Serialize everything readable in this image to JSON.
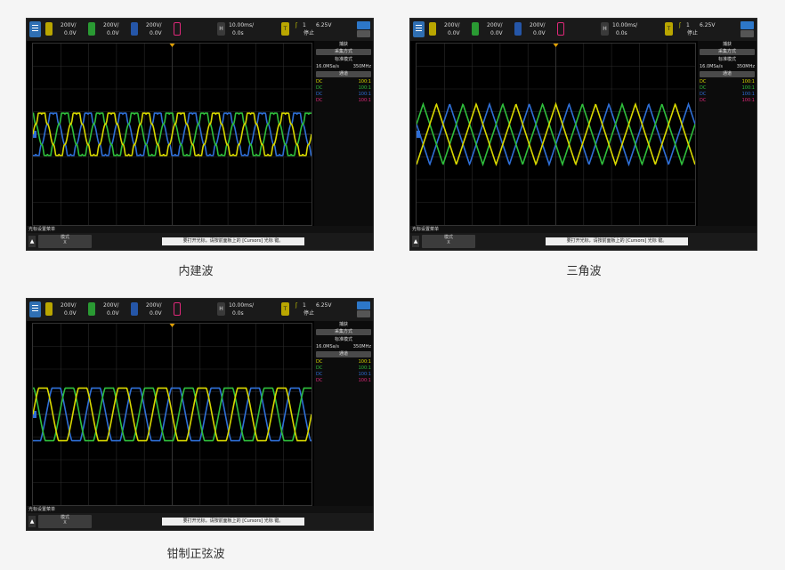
{
  "scopes": [
    {
      "caption": "内建波",
      "waveform": "builtin",
      "channels": [
        {
          "scale": "200V/",
          "offset": "0.0V",
          "color": "#d8d800"
        },
        {
          "scale": "200V/",
          "offset": "0.0V",
          "color": "#2fbe3c"
        },
        {
          "scale": "200V/",
          "offset": "0.0V",
          "color": "#2f6fd6"
        },
        {
          "scale": "",
          "offset": "",
          "color": "#e0287a"
        }
      ],
      "timebase": {
        "label": "H",
        "scale": "10.00ms/",
        "delay": "0.0s"
      },
      "trigger": {
        "label": "T",
        "slope": "ʃ",
        "channel": "1",
        "level": "6.25V",
        "status": "停止"
      },
      "side_panel": {
        "tab_label": "捕获",
        "acq_mode_button": "采集方式",
        "acq_mode_value": "标准模式",
        "sample_rate": "16.0MSa/s",
        "bandwidth": "350MHz",
        "channel_button": "通道",
        "channels": [
          {
            "coupling": "DC",
            "probe": "100:1",
            "color": "#d8d800"
          },
          {
            "coupling": "DC",
            "probe": "100:1",
            "color": "#2fbe3c"
          },
          {
            "coupling": "DC",
            "probe": "100:1",
            "color": "#2f6fd6"
          },
          {
            "coupling": "DC",
            "probe": "100:1",
            "color": "#e0287a"
          }
        ]
      },
      "status_line": "光标设置菜单",
      "softkey": {
        "label": "模式",
        "value": "X"
      },
      "message": "要打开光标，请按前面板上的 [Cursors] 光标 键。"
    },
    {
      "caption": "三角波",
      "waveform": "triangle",
      "channels": [
        {
          "scale": "200V/",
          "offset": "0.0V",
          "color": "#d8d800"
        },
        {
          "scale": "200V/",
          "offset": "0.0V",
          "color": "#2fbe3c"
        },
        {
          "scale": "200V/",
          "offset": "0.0V",
          "color": "#2f6fd6"
        },
        {
          "scale": "",
          "offset": "",
          "color": "#e0287a"
        }
      ],
      "timebase": {
        "label": "H",
        "scale": "10.00ms/",
        "delay": "0.0s"
      },
      "trigger": {
        "label": "T",
        "slope": "ʃ",
        "channel": "1",
        "level": "6.25V",
        "status": "停止"
      },
      "side_panel": {
        "tab_label": "捕获",
        "acq_mode_button": "采集方式",
        "acq_mode_value": "标准模式",
        "sample_rate": "16.0MSa/s",
        "bandwidth": "350MHz",
        "channel_button": "通道",
        "channels": [
          {
            "coupling": "DC",
            "probe": "100:1",
            "color": "#d8d800"
          },
          {
            "coupling": "DC",
            "probe": "100:1",
            "color": "#2fbe3c"
          },
          {
            "coupling": "DC",
            "probe": "100:1",
            "color": "#2f6fd6"
          },
          {
            "coupling": "DC",
            "probe": "100:1",
            "color": "#e0287a"
          }
        ]
      },
      "status_line": "光标设置菜单",
      "softkey": {
        "label": "模式",
        "value": "X"
      },
      "message": "要打开光标，请按前面板上的 [Cursors] 光标 键。"
    },
    {
      "caption": "钳制正弦波",
      "waveform": "clamped_sine",
      "channels": [
        {
          "scale": "200V/",
          "offset": "0.0V",
          "color": "#d8d800"
        },
        {
          "scale": "200V/",
          "offset": "0.0V",
          "color": "#2fbe3c"
        },
        {
          "scale": "200V/",
          "offset": "0.0V",
          "color": "#2f6fd6"
        },
        {
          "scale": "",
          "offset": "",
          "color": "#e0287a"
        }
      ],
      "timebase": {
        "label": "H",
        "scale": "10.00ms/",
        "delay": "0.0s"
      },
      "trigger": {
        "label": "T",
        "slope": "ʃ",
        "channel": "1",
        "level": "6.25V",
        "status": "停止"
      },
      "side_panel": {
        "tab_label": "捕获",
        "acq_mode_button": "采集方式",
        "acq_mode_value": "标准模式",
        "sample_rate": "16.0MSa/s",
        "bandwidth": "350MHz",
        "channel_button": "通道",
        "channels": [
          {
            "coupling": "DC",
            "probe": "100:1",
            "color": "#d8d800"
          },
          {
            "coupling": "DC",
            "probe": "100:1",
            "color": "#2fbe3c"
          },
          {
            "coupling": "DC",
            "probe": "100:1",
            "color": "#2f6fd6"
          },
          {
            "coupling": "DC",
            "probe": "100:1",
            "color": "#e0287a"
          }
        ]
      },
      "status_line": "光标设置菜单",
      "softkey": {
        "label": "模式",
        "value": "X"
      },
      "message": "要打开光标，请按前面板上的 [Cursors] 光标 键。"
    }
  ]
}
